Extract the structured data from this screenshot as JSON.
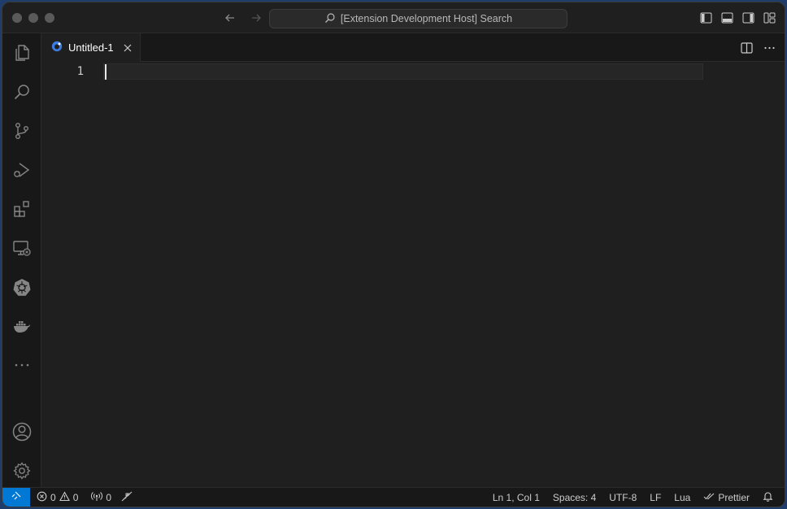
{
  "titlebar": {
    "search_text": "[Extension Development Host] Search"
  },
  "tabs": [
    {
      "label": "Untitled-1",
      "icon": "lua-file-icon"
    }
  ],
  "editor": {
    "line_numbers": [
      "1"
    ]
  },
  "activity_bar": {
    "items": [
      "explorer-icon",
      "search-icon",
      "source-control-icon",
      "run-debug-icon",
      "extensions-icon",
      "remote-explorer-icon",
      "kubernetes-icon",
      "docker-icon",
      "more-icon"
    ],
    "bottom_items": [
      "accounts-icon",
      "manage-gear-icon"
    ]
  },
  "statusbar": {
    "errors": "0",
    "warnings": "0",
    "ports": "0",
    "cursor_position": "Ln 1, Col 1",
    "indentation": "Spaces: 4",
    "encoding": "UTF-8",
    "eol": "LF",
    "language": "Lua",
    "formatter": "Prettier"
  },
  "colors": {
    "accent": "#0078d4",
    "background": "#1f1f1f"
  }
}
